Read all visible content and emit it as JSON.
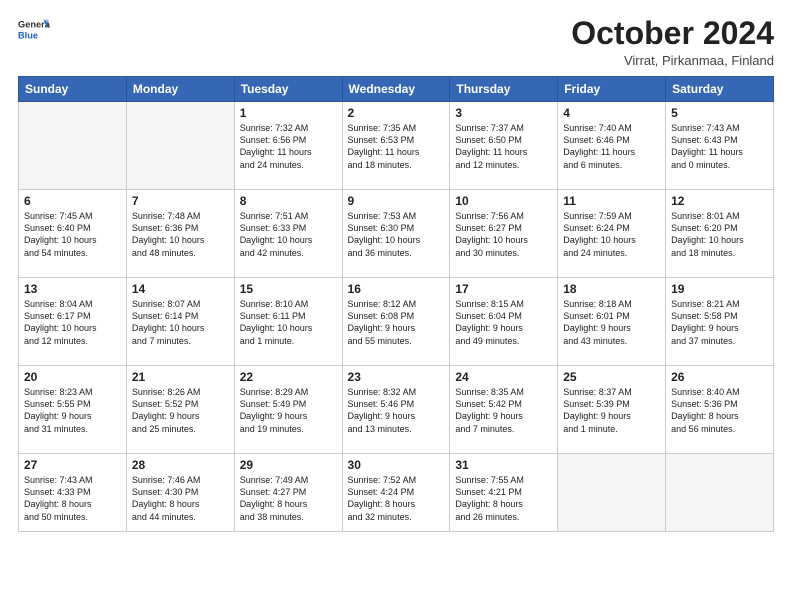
{
  "header": {
    "logo": {
      "line1": "General",
      "line2": "Blue"
    },
    "title": "October 2024",
    "location": "Virrat, Pirkanmaa, Finland"
  },
  "days_of_week": [
    "Sunday",
    "Monday",
    "Tuesday",
    "Wednesday",
    "Thursday",
    "Friday",
    "Saturday"
  ],
  "weeks": [
    [
      {
        "day": "",
        "empty": true,
        "lines": []
      },
      {
        "day": "",
        "empty": true,
        "lines": []
      },
      {
        "day": "1",
        "lines": [
          "Sunrise: 7:32 AM",
          "Sunset: 6:56 PM",
          "Daylight: 11 hours",
          "and 24 minutes."
        ]
      },
      {
        "day": "2",
        "lines": [
          "Sunrise: 7:35 AM",
          "Sunset: 6:53 PM",
          "Daylight: 11 hours",
          "and 18 minutes."
        ]
      },
      {
        "day": "3",
        "lines": [
          "Sunrise: 7:37 AM",
          "Sunset: 6:50 PM",
          "Daylight: 11 hours",
          "and 12 minutes."
        ]
      },
      {
        "day": "4",
        "lines": [
          "Sunrise: 7:40 AM",
          "Sunset: 6:46 PM",
          "Daylight: 11 hours",
          "and 6 minutes."
        ]
      },
      {
        "day": "5",
        "lines": [
          "Sunrise: 7:43 AM",
          "Sunset: 6:43 PM",
          "Daylight: 11 hours",
          "and 0 minutes."
        ]
      }
    ],
    [
      {
        "day": "6",
        "lines": [
          "Sunrise: 7:45 AM",
          "Sunset: 6:40 PM",
          "Daylight: 10 hours",
          "and 54 minutes."
        ]
      },
      {
        "day": "7",
        "lines": [
          "Sunrise: 7:48 AM",
          "Sunset: 6:36 PM",
          "Daylight: 10 hours",
          "and 48 minutes."
        ]
      },
      {
        "day": "8",
        "lines": [
          "Sunrise: 7:51 AM",
          "Sunset: 6:33 PM",
          "Daylight: 10 hours",
          "and 42 minutes."
        ]
      },
      {
        "day": "9",
        "lines": [
          "Sunrise: 7:53 AM",
          "Sunset: 6:30 PM",
          "Daylight: 10 hours",
          "and 36 minutes."
        ]
      },
      {
        "day": "10",
        "lines": [
          "Sunrise: 7:56 AM",
          "Sunset: 6:27 PM",
          "Daylight: 10 hours",
          "and 30 minutes."
        ]
      },
      {
        "day": "11",
        "lines": [
          "Sunrise: 7:59 AM",
          "Sunset: 6:24 PM",
          "Daylight: 10 hours",
          "and 24 minutes."
        ]
      },
      {
        "day": "12",
        "lines": [
          "Sunrise: 8:01 AM",
          "Sunset: 6:20 PM",
          "Daylight: 10 hours",
          "and 18 minutes."
        ]
      }
    ],
    [
      {
        "day": "13",
        "lines": [
          "Sunrise: 8:04 AM",
          "Sunset: 6:17 PM",
          "Daylight: 10 hours",
          "and 12 minutes."
        ]
      },
      {
        "day": "14",
        "lines": [
          "Sunrise: 8:07 AM",
          "Sunset: 6:14 PM",
          "Daylight: 10 hours",
          "and 7 minutes."
        ]
      },
      {
        "day": "15",
        "lines": [
          "Sunrise: 8:10 AM",
          "Sunset: 6:11 PM",
          "Daylight: 10 hours",
          "and 1 minute."
        ]
      },
      {
        "day": "16",
        "lines": [
          "Sunrise: 8:12 AM",
          "Sunset: 6:08 PM",
          "Daylight: 9 hours",
          "and 55 minutes."
        ]
      },
      {
        "day": "17",
        "lines": [
          "Sunrise: 8:15 AM",
          "Sunset: 6:04 PM",
          "Daylight: 9 hours",
          "and 49 minutes."
        ]
      },
      {
        "day": "18",
        "lines": [
          "Sunrise: 8:18 AM",
          "Sunset: 6:01 PM",
          "Daylight: 9 hours",
          "and 43 minutes."
        ]
      },
      {
        "day": "19",
        "lines": [
          "Sunrise: 8:21 AM",
          "Sunset: 5:58 PM",
          "Daylight: 9 hours",
          "and 37 minutes."
        ]
      }
    ],
    [
      {
        "day": "20",
        "lines": [
          "Sunrise: 8:23 AM",
          "Sunset: 5:55 PM",
          "Daylight: 9 hours",
          "and 31 minutes."
        ]
      },
      {
        "day": "21",
        "lines": [
          "Sunrise: 8:26 AM",
          "Sunset: 5:52 PM",
          "Daylight: 9 hours",
          "and 25 minutes."
        ]
      },
      {
        "day": "22",
        "lines": [
          "Sunrise: 8:29 AM",
          "Sunset: 5:49 PM",
          "Daylight: 9 hours",
          "and 19 minutes."
        ]
      },
      {
        "day": "23",
        "lines": [
          "Sunrise: 8:32 AM",
          "Sunset: 5:46 PM",
          "Daylight: 9 hours",
          "and 13 minutes."
        ]
      },
      {
        "day": "24",
        "lines": [
          "Sunrise: 8:35 AM",
          "Sunset: 5:42 PM",
          "Daylight: 9 hours",
          "and 7 minutes."
        ]
      },
      {
        "day": "25",
        "lines": [
          "Sunrise: 8:37 AM",
          "Sunset: 5:39 PM",
          "Daylight: 9 hours",
          "and 1 minute."
        ]
      },
      {
        "day": "26",
        "lines": [
          "Sunrise: 8:40 AM",
          "Sunset: 5:36 PM",
          "Daylight: 8 hours",
          "and 56 minutes."
        ]
      }
    ],
    [
      {
        "day": "27",
        "lines": [
          "Sunrise: 7:43 AM",
          "Sunset: 4:33 PM",
          "Daylight: 8 hours",
          "and 50 minutes."
        ]
      },
      {
        "day": "28",
        "lines": [
          "Sunrise: 7:46 AM",
          "Sunset: 4:30 PM",
          "Daylight: 8 hours",
          "and 44 minutes."
        ]
      },
      {
        "day": "29",
        "lines": [
          "Sunrise: 7:49 AM",
          "Sunset: 4:27 PM",
          "Daylight: 8 hours",
          "and 38 minutes."
        ]
      },
      {
        "day": "30",
        "lines": [
          "Sunrise: 7:52 AM",
          "Sunset: 4:24 PM",
          "Daylight: 8 hours",
          "and 32 minutes."
        ]
      },
      {
        "day": "31",
        "lines": [
          "Sunrise: 7:55 AM",
          "Sunset: 4:21 PM",
          "Daylight: 8 hours",
          "and 26 minutes."
        ]
      },
      {
        "day": "",
        "empty": true,
        "lines": []
      },
      {
        "day": "",
        "empty": true,
        "lines": []
      }
    ]
  ]
}
